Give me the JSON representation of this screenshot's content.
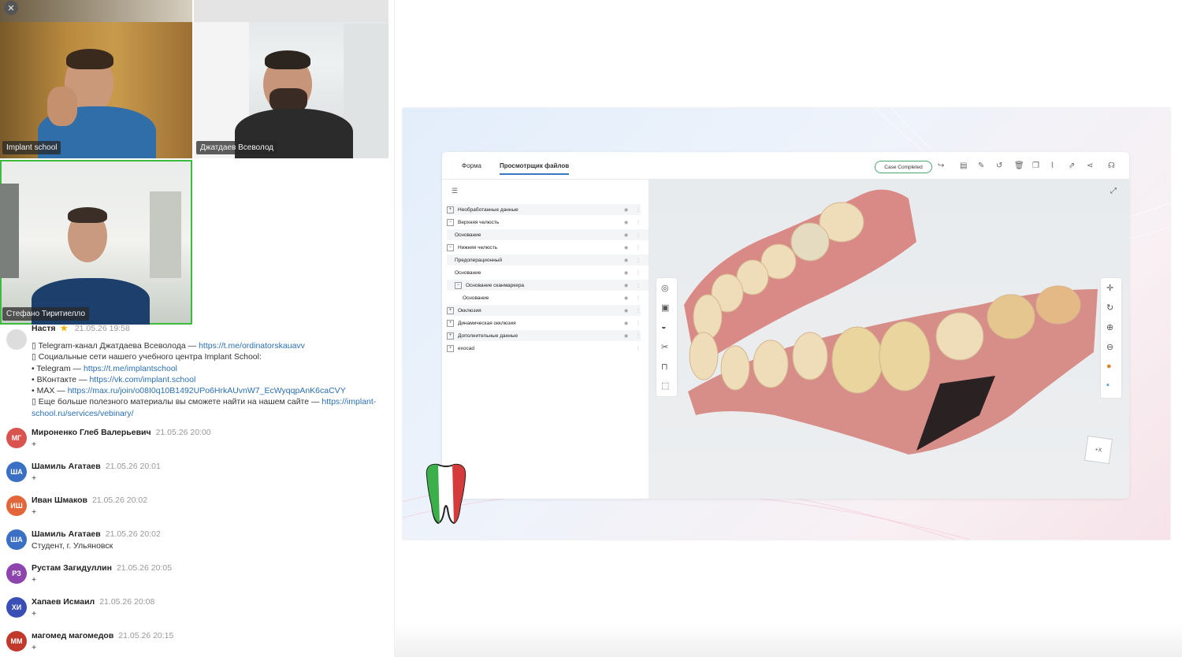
{
  "participants": [
    {
      "name": "Implant school"
    },
    {
      "name": "Джатдаев Всеволод"
    },
    {
      "name": "Стефано Тиритиелло"
    }
  ],
  "chat": {
    "pinned": {
      "author": "Настя",
      "time": "21.05.26 19:58",
      "line1_text": "Telegram-канал Джатдаева Всеволода — ",
      "line1_link": "https://t.me/ordinatorskauavv",
      "line2_text": "Социальные сети нашего учебного центра Implant School:",
      "line3_text": "• Telegram — ",
      "line3_link": "https://t.me/implantschool",
      "line4_text": "• ВКонтакте — ",
      "line4_link": "https://vk.com/implant.school",
      "line5_text": "• MAX — ",
      "line5_link": "https://max.ru/join/o08I0q10B1492UPo6HrkAUvnW7_EcWyqqpAnK6caCVY",
      "line6_text": "Еще больше полезного материалы вы сможете найти на нашем сайте — ",
      "line6_link_a": "https://implant-",
      "line7_link_b": "school.ru/services/vebinary/"
    },
    "messages": [
      {
        "initials": "МГ",
        "author": "Мироненко Глеб Валерьевич",
        "time": "21.05.26 20:00",
        "text": "+",
        "color": "#d9534f"
      },
      {
        "initials": "ША",
        "author": "Шамиль Агатаев",
        "time": "21.05.26 20:01",
        "text": "+",
        "color": "#3a6fc4"
      },
      {
        "initials": "ИШ",
        "author": "Иван Шмаков",
        "time": "21.05.26 20:02",
        "text": "+",
        "color": "#e2663a"
      },
      {
        "initials": "ША",
        "author": "Шамиль Агатаев",
        "time": "21.05.26 20:02",
        "text": "Студент, г. Ульяновск",
        "color": "#3a6fc4"
      },
      {
        "initials": "РЗ",
        "author": "Рустам Загидуллин",
        "time": "21.05.26 20:05",
        "text": "+",
        "color": "#8e44ad"
      },
      {
        "initials": "ХИ",
        "author": "Хапаев Исмаил",
        "time": "21.05.26 20:08",
        "text": "+",
        "color": "#3a4fb5"
      },
      {
        "initials": "ММ",
        "author": "магомед магомедов",
        "time": "21.05.26 20:15",
        "text": "+",
        "color": "#c0392b"
      }
    ]
  },
  "app": {
    "tabs": [
      "Форма",
      "Просмотрщик файлов"
    ],
    "case_button": "Case Completed",
    "tree": [
      {
        "label": "Необработанные данные",
        "indent": 0,
        "toggle": "+"
      },
      {
        "label": "Верхняя челюсть",
        "indent": 0,
        "toggle": "−"
      },
      {
        "label": "Основание",
        "indent": 1,
        "toggle": ""
      },
      {
        "label": "Нижняя челюсть",
        "indent": 0,
        "toggle": "−"
      },
      {
        "label": "Предоперационный",
        "indent": 1,
        "toggle": ""
      },
      {
        "label": "Основание",
        "indent": 1,
        "toggle": ""
      },
      {
        "label": "Основание сканмаркера",
        "indent": 1,
        "toggle": "−"
      },
      {
        "label": "Основание",
        "indent": 2,
        "toggle": ""
      },
      {
        "label": "Окклюзия",
        "indent": 0,
        "toggle": "+"
      },
      {
        "label": "Динамическая окклюзия",
        "indent": 0,
        "toggle": "+"
      },
      {
        "label": "Дополнительные данные",
        "indent": 0,
        "toggle": "+"
      },
      {
        "label": "exocad",
        "indent": 0,
        "toggle": "+"
      }
    ]
  }
}
